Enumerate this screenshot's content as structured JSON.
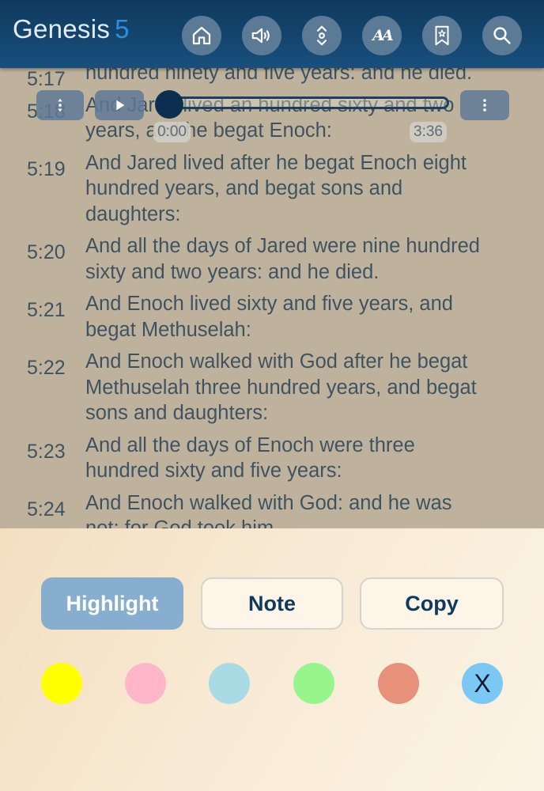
{
  "header": {
    "book": "Genesis",
    "chapter": "5",
    "icons": [
      "home-icon",
      "speaker-icon",
      "scroll-arrows-icon",
      "font-size-icon",
      "bookmark-icon",
      "search-icon"
    ],
    "font_icon_text": "AA"
  },
  "player": {
    "elapsed": "0:00",
    "duration": "3:36",
    "progress": 0.0
  },
  "verses": [
    {
      "num": "5:17",
      "lines": [
        "hundred ninety and five years: and he died."
      ]
    },
    {
      "num": "5:18",
      "lines": [
        "And Jared lived an hundred sixty and two",
        "years, and he begat Enoch:"
      ]
    },
    {
      "num": "5:19",
      "lines": [
        "And Jared lived after he begat Enoch eight",
        "hundred years, and begat sons and",
        "daughters:"
      ]
    },
    {
      "num": "5:20",
      "lines": [
        "And all the days of Jared were nine hundred",
        "sixty and two years: and he died."
      ]
    },
    {
      "num": "5:21",
      "lines": [
        "And Enoch lived sixty and five years, and",
        "begat Methuselah:"
      ]
    },
    {
      "num": "5:22",
      "lines": [
        "And Enoch walked with God after he begat",
        "Methuselah three hundred years, and begat",
        "sons and daughters:"
      ]
    },
    {
      "num": "5:23",
      "lines": [
        "And all the days of Enoch were three",
        "hundred sixty and five years:"
      ]
    },
    {
      "num": "5:24",
      "lines": [
        "And Enoch walked with God: and he was",
        "not; for God took him."
      ]
    }
  ],
  "actions": {
    "highlight": "Highlight",
    "note": "Note",
    "copy": "Copy"
  },
  "swatches": [
    {
      "name": "yellow",
      "color": "#ffff00"
    },
    {
      "name": "pink",
      "color": "#ffb6c8"
    },
    {
      "name": "light-blue",
      "color": "#a9dbe4"
    },
    {
      "name": "green",
      "color": "#97f58e"
    },
    {
      "name": "salmon",
      "color": "#e8917a"
    }
  ],
  "clear_swatch": {
    "label": "X",
    "color": "#7bc8f5"
  },
  "colors": {
    "header_bg": "#0f3a5d",
    "chapter_accent": "#2e8de0",
    "verse_text": "#0f3a5d",
    "highlight_button": "#87adcf"
  }
}
